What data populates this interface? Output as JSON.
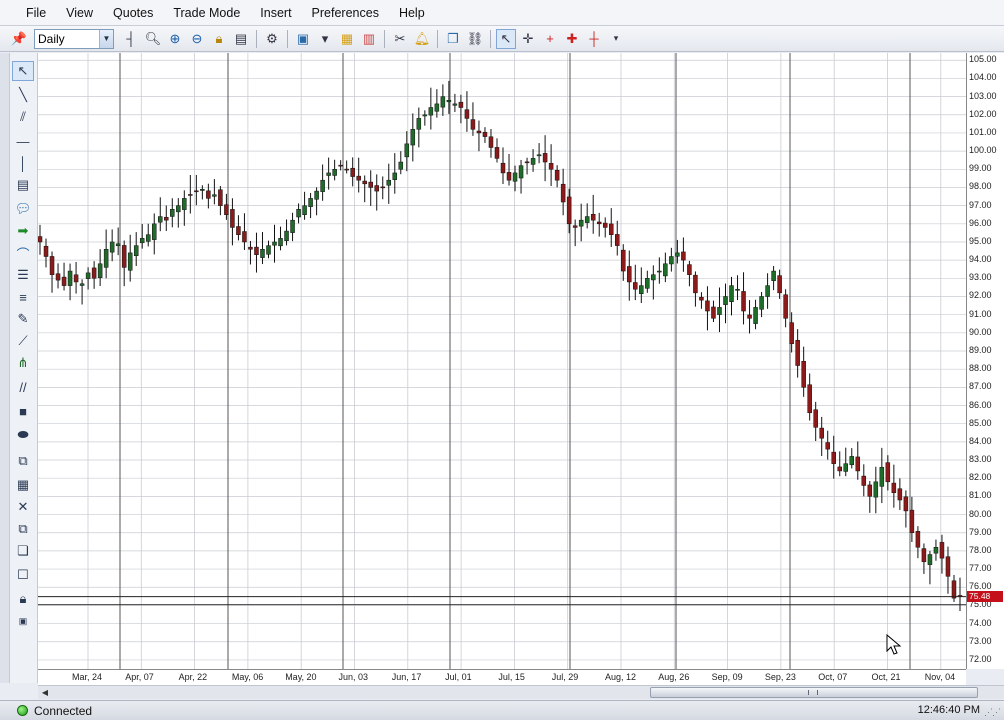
{
  "menu": [
    "File",
    "View",
    "Quotes",
    "Trade Mode",
    "Insert",
    "Preferences",
    "Help"
  ],
  "toolbar": {
    "period": "Daily"
  },
  "price_axis": {
    "ticks": [
      "105.00",
      "104.00",
      "103.00",
      "102.00",
      "101.00",
      "100.00",
      "99.00",
      "98.00",
      "97.00",
      "96.00",
      "95.00",
      "94.00",
      "93.00",
      "92.00",
      "91.00",
      "90.00",
      "89.00",
      "88.00",
      "87.00",
      "86.00",
      "85.00",
      "84.00",
      "83.00",
      "82.00",
      "81.00",
      "80.00",
      "79.00",
      "78.00",
      "77.00",
      "76.00",
      "75.00",
      "74.00",
      "73.00",
      "72.00"
    ],
    "last_price": "75.48"
  },
  "date_axis": {
    "ticks": [
      "Mar, 24",
      "Apr, 07",
      "Apr, 22",
      "May, 06",
      "May, 20",
      "Jun, 03",
      "Jun, 17",
      "Jul, 01",
      "Jul, 15",
      "Jul, 29",
      "Aug, 12",
      "Aug, 26",
      "Sep, 09",
      "Sep, 23",
      "Oct, 07",
      "Oct, 21",
      "Nov, 04"
    ]
  },
  "status": {
    "connection": "Connected",
    "time": "12:46:40 PM"
  },
  "colors": {
    "up": "#1f6b2a",
    "down": "#8b1a1a",
    "grid": "#c8ccd2",
    "major_grid": "#555555",
    "price_line": "#222222",
    "last_price_tag": "#c4101a"
  },
  "chart_data": {
    "type": "candlestick",
    "timeframe": "Daily",
    "ylim": [
      71.5,
      105.4
    ],
    "x_tick_labels": [
      "Mar, 24",
      "Apr, 07",
      "Apr, 22",
      "May, 06",
      "May, 20",
      "Jun, 03",
      "Jun, 17",
      "Jul, 01",
      "Jul, 15",
      "Jul, 29",
      "Aug, 12",
      "Aug, 26",
      "Sep, 09",
      "Sep, 23",
      "Oct, 07",
      "Oct, 21",
      "Nov, 04"
    ],
    "approx_close_series": [
      95.0,
      94.2,
      93.2,
      92.9,
      92.6,
      93.4,
      92.8,
      92.7,
      93.3,
      93.0,
      93.8,
      94.6,
      95.0,
      94.9,
      93.6,
      94.4,
      94.8,
      95.2,
      95.4,
      96.0,
      96.4,
      96.2,
      96.8,
      97.0,
      97.4,
      97.6,
      97.8,
      97.9,
      97.4,
      97.6,
      97.0,
      96.5,
      95.8,
      95.4,
      95.0,
      94.6,
      94.3,
      94.6,
      94.8,
      95.0,
      95.2,
      95.6,
      96.2,
      96.8,
      97.0,
      97.4,
      97.8,
      98.4,
      98.8,
      99.0,
      99.2,
      99.0,
      98.6,
      98.4,
      98.2,
      98.0,
      97.8,
      98.0,
      98.4,
      98.8,
      99.4,
      100.4,
      101.2,
      101.8,
      102.0,
      102.4,
      102.6,
      103.0,
      102.8,
      102.6,
      102.4,
      101.8,
      101.2,
      101.0,
      100.8,
      100.2,
      99.6,
      98.8,
      98.4,
      98.8,
      99.2,
      99.4,
      99.6,
      99.8,
      99.4,
      99.0,
      98.4,
      97.2,
      96.0,
      95.8,
      96.2,
      96.4,
      96.2,
      96.0,
      95.8,
      95.4,
      94.8,
      93.4,
      92.8,
      92.4,
      92.6,
      93.0,
      93.2,
      93.4,
      93.8,
      94.2,
      94.4,
      94.0,
      93.2,
      92.2,
      91.8,
      91.2,
      90.8,
      91.4,
      92.0,
      92.6,
      92.4,
      91.2,
      90.8,
      91.4,
      92.0,
      92.6,
      93.4,
      92.2,
      90.8,
      89.4,
      88.2,
      87.0,
      85.6,
      84.8,
      84.2,
      83.6,
      82.8,
      82.4,
      82.8,
      83.2,
      82.4,
      81.6,
      81.0,
      81.8,
      82.6,
      81.8,
      81.2,
      80.8,
      80.2,
      79.0,
      78.2,
      77.4,
      77.8,
      78.2,
      77.6,
      76.6,
      75.4,
      75.48
    ],
    "last_price": 75.48
  }
}
